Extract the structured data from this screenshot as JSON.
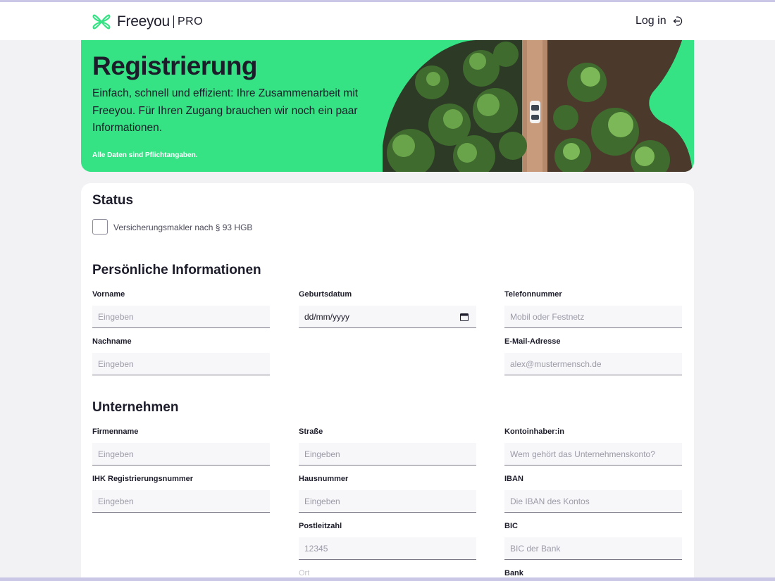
{
  "header": {
    "brand": "Freeyou",
    "brand_suffix": "PRO",
    "login_label": "Log in"
  },
  "hero": {
    "title": "Registrierung",
    "description": "Einfach, schnell und effizient: Ihre Zusammenarbeit mit Freeyou. Für Ihren Zugang brauchen wir noch ein paar Informationen.",
    "note": "Alle Daten sind Pflichtangaben."
  },
  "status": {
    "title": "Status",
    "checkbox_label": "Versicherungsmakler nach § 93 HGB"
  },
  "personal": {
    "title": "Persönliche Informationen",
    "first_name": {
      "label": "Vorname",
      "placeholder": "Eingeben"
    },
    "last_name": {
      "label": "Nachname",
      "placeholder": "Eingeben"
    },
    "birthdate": {
      "label": "Geburtsdatum",
      "value": "dd/mm/yyyy"
    },
    "phone": {
      "label": "Telefonnummer",
      "placeholder": "Mobil oder Festnetz"
    },
    "email": {
      "label": "E-Mail-Adresse",
      "placeholder": "alex@mustermensch.de"
    }
  },
  "company": {
    "title": "Unternehmen",
    "company_name": {
      "label": "Firmenname",
      "placeholder": "Eingeben"
    },
    "ihk_number": {
      "label": "IHK Registrierungsnummer",
      "placeholder": "Eingeben"
    },
    "street": {
      "label": "Straße",
      "placeholder": "Eingeben"
    },
    "house_number": {
      "label": "Hausnummer",
      "placeholder": "Eingeben"
    },
    "postal_code": {
      "label": "Postleitzahl",
      "placeholder": "12345"
    },
    "city": {
      "label": "Ort"
    },
    "account_holder": {
      "label": "Kontoinhaber:in",
      "placeholder": "Wem gehört das Unternehmenskonto?"
    },
    "iban": {
      "label": "IBAN",
      "placeholder": "Die IBAN des Kontos"
    },
    "bic": {
      "label": "BIC",
      "placeholder": "BIC der Bank"
    },
    "bank": {
      "label": "Bank"
    }
  },
  "colors": {
    "brand_green": "#35e384",
    "ink": "#1c1c2b",
    "page_bg": "#f2f1f4"
  },
  "icons": {
    "logo": "freeyou-logo-icon",
    "login": "login-arrow-icon",
    "calendar": "calendar-icon"
  }
}
